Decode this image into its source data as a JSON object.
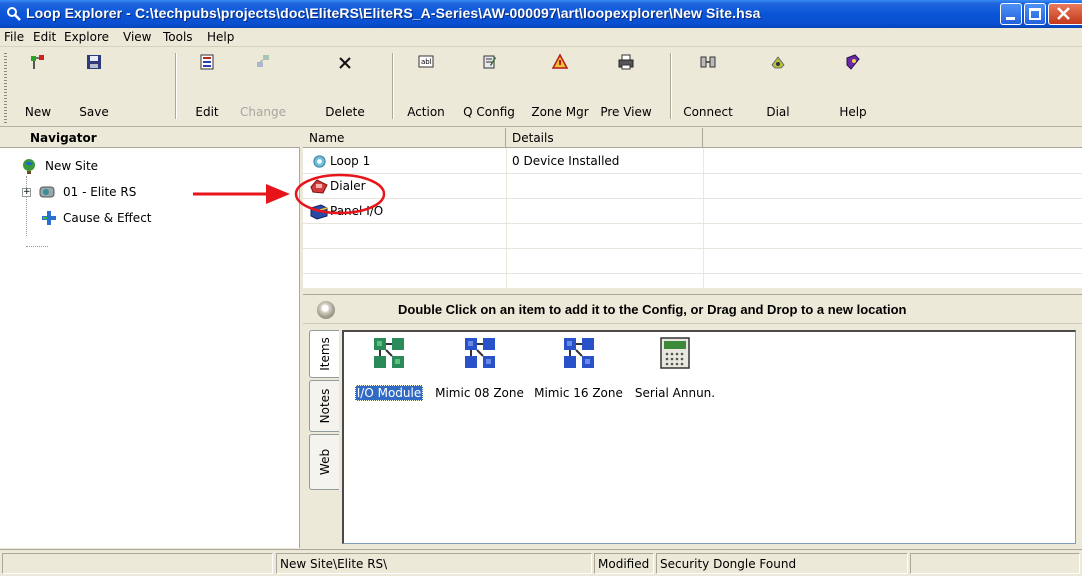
{
  "window": {
    "title": "Loop Explorer - C:\\techpubs\\projects\\doc\\EliteRS\\EliteRS_A-Series\\AW-000097\\art\\loopexplorer\\New Site.hsa"
  },
  "menu": [
    "File",
    "Edit",
    "Explore",
    "View",
    "Tools",
    "Help"
  ],
  "toolbar": {
    "new": "New",
    "save": "Save",
    "edit": "Edit",
    "change": "Change",
    "delete": "Delete",
    "action": "Action",
    "qconfig": "Q Config",
    "zonemgr": "Zone Mgr",
    "preview": "Pre View",
    "connect": "Connect",
    "dial": "Dial",
    "help": "Help"
  },
  "navigator": {
    "header": "Navigator",
    "items": [
      {
        "label": "New Site",
        "icon": "globe-icon"
      },
      {
        "label": "01 - Elite RS",
        "icon": "panel-icon",
        "expander": "+"
      },
      {
        "label": "Cause & Effect",
        "icon": "cause-effect-icon"
      }
    ]
  },
  "list": {
    "columns": [
      "Name",
      "Details"
    ],
    "rows": [
      {
        "name": "Loop 1",
        "details": "0 Device Installed",
        "icon": "loop-icon"
      },
      {
        "name": "Dialer",
        "details": "",
        "icon": "dialer-phone-icon"
      },
      {
        "name": "Panel I/O",
        "details": "",
        "icon": "panel-io-icon"
      }
    ]
  },
  "palette": {
    "title": "Double Click on an item to add it to the Config, or Drag and Drop to a new location",
    "tabs": [
      "Items",
      "Notes",
      "Web"
    ],
    "items": [
      {
        "label": "I/O Module",
        "icon": "io-module-icon",
        "selected": true
      },
      {
        "label": "Mimic 08 Zone",
        "icon": "mimic-icon",
        "selected": false
      },
      {
        "label": "Mimic 16 Zone",
        "icon": "mimic-icon",
        "selected": false
      },
      {
        "label": "Serial Annun.",
        "icon": "serial-annunciator-icon",
        "selected": false
      }
    ]
  },
  "status": {
    "path": "New Site\\Elite RS\\",
    "modified": "Modified",
    "dongle": "Security Dongle Found"
  },
  "colors": {
    "titlebar": "#0a55d8",
    "selection": "#316ac5",
    "annotation": "#e8141c"
  }
}
